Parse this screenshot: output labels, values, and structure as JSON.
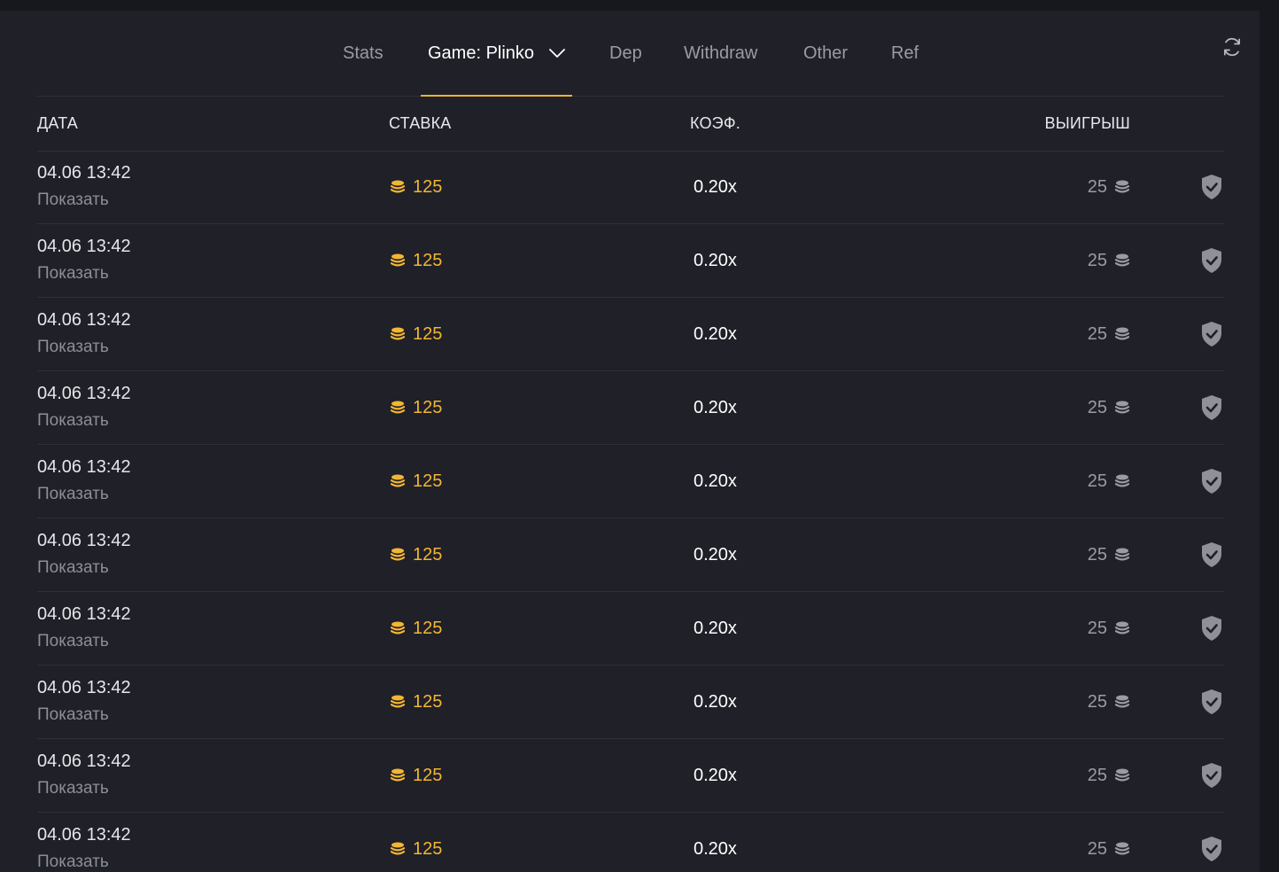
{
  "tabs": [
    {
      "label": "Stats"
    },
    {
      "label": "Game: Plinko"
    },
    {
      "label": "Dep"
    },
    {
      "label": "Withdraw"
    },
    {
      "label": "Other"
    },
    {
      "label": "Ref"
    }
  ],
  "table": {
    "columns": {
      "date": "ДАТА",
      "bet": "СТАВКА",
      "coef": "КОЭФ.",
      "win": "ВЫИГРЫШ"
    },
    "rows": [
      {
        "date": "04.06 13:42",
        "show": "Показать",
        "bet": "125",
        "coef": "0.20x",
        "win": "25"
      },
      {
        "date": "04.06 13:42",
        "show": "Показать",
        "bet": "125",
        "coef": "0.20x",
        "win": "25"
      },
      {
        "date": "04.06 13:42",
        "show": "Показать",
        "bet": "125",
        "coef": "0.20x",
        "win": "25"
      },
      {
        "date": "04.06 13:42",
        "show": "Показать",
        "bet": "125",
        "coef": "0.20x",
        "win": "25"
      },
      {
        "date": "04.06 13:42",
        "show": "Показать",
        "bet": "125",
        "coef": "0.20x",
        "win": "25"
      },
      {
        "date": "04.06 13:42",
        "show": "Показать",
        "bet": "125",
        "coef": "0.20x",
        "win": "25"
      },
      {
        "date": "04.06 13:42",
        "show": "Показать",
        "bet": "125",
        "coef": "0.20x",
        "win": "25"
      },
      {
        "date": "04.06 13:42",
        "show": "Показать",
        "bet": "125",
        "coef": "0.20x",
        "win": "25"
      },
      {
        "date": "04.06 13:42",
        "show": "Показать",
        "bet": "125",
        "coef": "0.20x",
        "win": "25"
      },
      {
        "date": "04.06 13:42",
        "show": "Показать",
        "bet": "125",
        "coef": "0.20x",
        "win": "25"
      }
    ]
  },
  "icons": {
    "refresh": "refresh-icon",
    "dropdown": "chevron-down-icon",
    "coin": "coin-stack-icon",
    "shield": "shield-check-icon"
  },
  "colors": {
    "background": "#17181d",
    "panel": "#1f2028",
    "accent": "#f0b429",
    "coin": "#f2b632",
    "muted": "#9a9ba3"
  }
}
